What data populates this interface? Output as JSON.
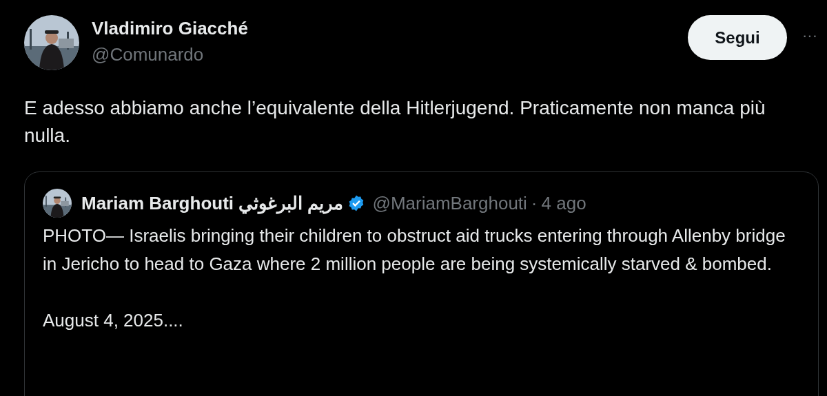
{
  "post": {
    "author": {
      "name": "Vladimiro Giacché",
      "handle": "@Comunardo"
    },
    "follow_button": "Segui",
    "more": "···",
    "text": "E adesso abbiamo anche l’equivalente della Hitlerjugend. Praticamente non manca più nulla.",
    "quoted_post": {
      "author": {
        "name": "Mariam Barghouti مريم البرغوثي",
        "verified": true,
        "handle": "@MariamBarghouti"
      },
      "separator": "·",
      "time": "4 ago",
      "text": "PHOTO— Israelis bringing their children to obstruct aid trucks entering through Allenby bridge in Jericho to head to Gaza where 2 million people are being systemically starved & bombed.\n\nAugust 4, 2025...."
    }
  }
}
